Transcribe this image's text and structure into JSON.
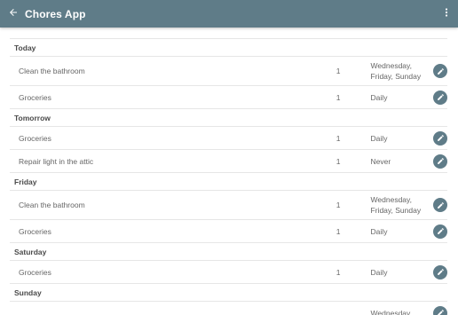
{
  "appbar": {
    "title": "Chores App",
    "back_icon": "arrow-back-icon",
    "menu_icon": "more-vert-icon",
    "color": "#5f7c88"
  },
  "sections": [
    {
      "day": "Today",
      "chores": [
        {
          "name": "Clean the bathroom",
          "count": "1",
          "frequency": "Wednesday, Friday, Sunday"
        },
        {
          "name": "Groceries",
          "count": "1",
          "frequency": "Daily"
        }
      ]
    },
    {
      "day": "Tomorrow",
      "chores": [
        {
          "name": "Groceries",
          "count": "1",
          "frequency": "Daily"
        },
        {
          "name": "Repair light in the attic",
          "count": "1",
          "frequency": "Never"
        }
      ]
    },
    {
      "day": "Friday",
      "chores": [
        {
          "name": "Clean the bathroom",
          "count": "1",
          "frequency": "Wednesday, Friday, Sunday"
        },
        {
          "name": "Groceries",
          "count": "1",
          "frequency": "Daily"
        }
      ]
    },
    {
      "day": "Saturday",
      "chores": [
        {
          "name": "Groceries",
          "count": "1",
          "frequency": "Daily"
        }
      ]
    },
    {
      "day": "Sunday",
      "chores": [
        {
          "name": "",
          "count": "",
          "frequency": "Wednesday,"
        }
      ]
    }
  ]
}
